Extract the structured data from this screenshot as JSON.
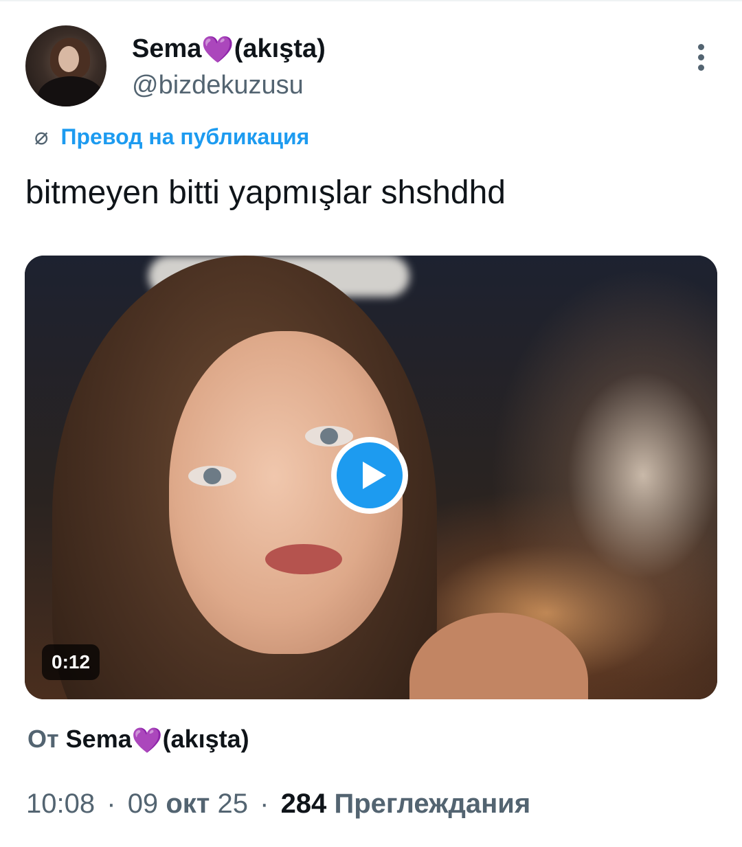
{
  "author": {
    "name": "Sema",
    "name_suffix": "(akışta)",
    "emoji": "💜",
    "handle": "@bizdekuzusu"
  },
  "icons": {
    "more": "more-vertical-icon",
    "translate": "globe-icon",
    "play": "play-icon"
  },
  "translate_label": "Превод на публикация",
  "tweet_text": "bitmeyen bitti yapmışlar shshdhd",
  "media": {
    "type": "video",
    "duration": "0:12"
  },
  "from": {
    "prefix": "От",
    "name": "Sema",
    "emoji": "💜",
    "suffix": "(akışta)"
  },
  "meta": {
    "time": "10:08",
    "day": "09",
    "month": "окт",
    "year": "25",
    "separator": "·",
    "views_count": "284",
    "views_label": "Преглеждания"
  },
  "colors": {
    "accent": "#1d9bf0",
    "heart": "#9b3be0",
    "secondary_text": "#536471"
  }
}
